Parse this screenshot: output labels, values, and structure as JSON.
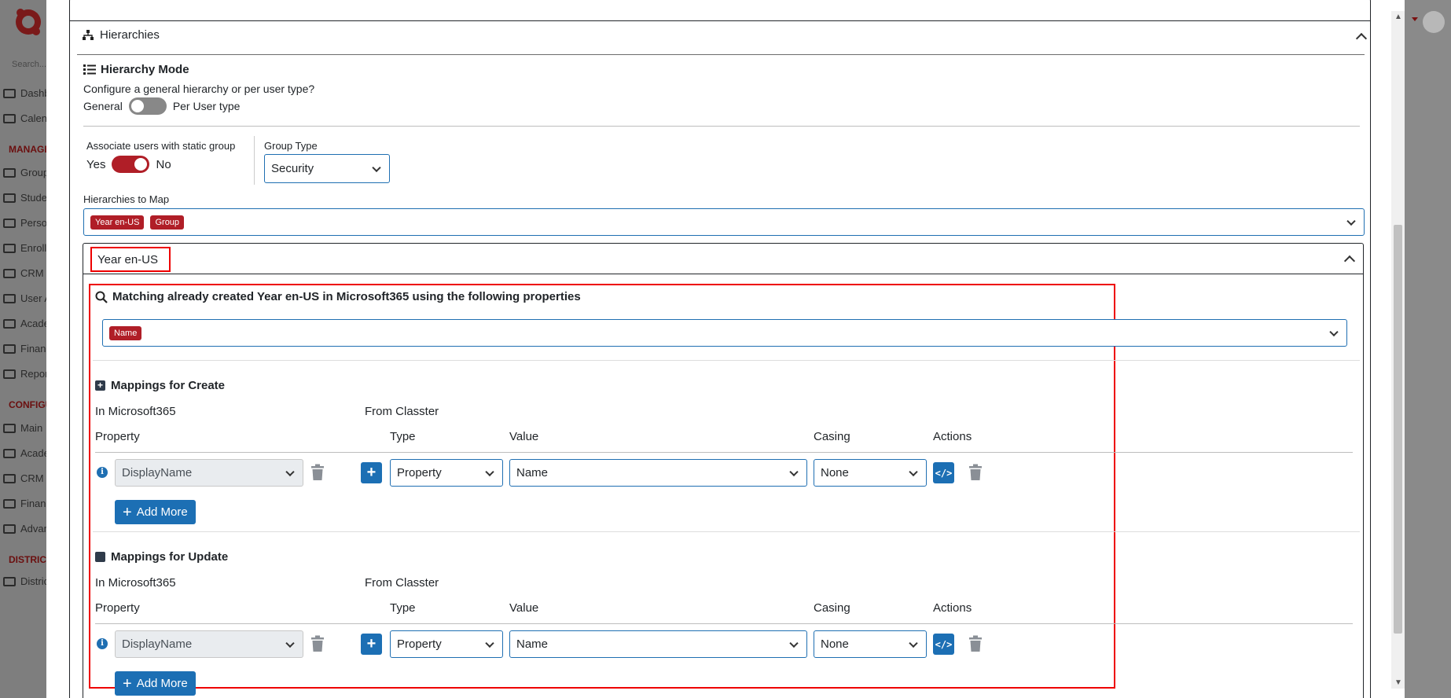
{
  "background": {
    "search_placeholder": "Search...",
    "items": [
      {
        "label": "Dashboard",
        "icon": "laptop-icon"
      },
      {
        "label": "Calendar",
        "icon": "calendar-icon"
      },
      {
        "label": "Groups",
        "icon": "groups-icon"
      },
      {
        "label": "Students",
        "icon": "students-icon"
      },
      {
        "label": "Persons",
        "icon": "person-icon"
      },
      {
        "label": "Enrollments",
        "icon": "enroll-icon"
      },
      {
        "label": "CRM",
        "icon": "crm-icon"
      },
      {
        "label": "User Access",
        "icon": "key-icon"
      },
      {
        "label": "Academics",
        "icon": "grid-icon"
      },
      {
        "label": "Finance",
        "icon": "coins-icon"
      },
      {
        "label": "Reports",
        "icon": "report-icon"
      },
      {
        "label": "Main",
        "icon": "sliders-icon"
      },
      {
        "label": "Academics",
        "icon": "grid-icon"
      },
      {
        "label": "CRM Settings",
        "icon": "crm-icon"
      },
      {
        "label": "Finance",
        "icon": "coins-icon"
      },
      {
        "label": "Advanced",
        "icon": "gear-icon"
      },
      {
        "label": "Districts",
        "icon": "list-icon"
      }
    ],
    "sections": [
      "MANAGE",
      "CONFIGURE",
      "DISTRICTS"
    ]
  },
  "hierarchies": {
    "title": "Hierarchies",
    "mode_title": "Hierarchy Mode",
    "mode_desc": "Configure a general hierarchy or per user type?",
    "toggle_left": "General",
    "toggle_right": "Per User type",
    "associate_label": "Associate users with static group",
    "associate_yes": "Yes",
    "associate_no": "No",
    "group_type_label": "Group Type",
    "group_type_value": "Security",
    "map_label": "Hierarchies to Map",
    "map_tags": [
      "Year en-US",
      "Group"
    ]
  },
  "year_panel": {
    "title": "Year en-US",
    "match_title": "Matching already created Year en-US in Microsoft365 using the following properties",
    "match_tags": [
      "Name"
    ],
    "create": {
      "title": "Mappings for Create",
      "in_label": "In Microsoft365",
      "from_label": "From Classter",
      "col_property": "Property",
      "col_type": "Type",
      "col_value": "Value",
      "col_casing": "Casing",
      "col_actions": "Actions",
      "property_value": "DisplayName",
      "type_value": "Property",
      "value_value": "Name",
      "casing_value": "None",
      "add_more": "Add More"
    },
    "update": {
      "title": "Mappings for Update",
      "in_label": "In Microsoft365",
      "from_label": "From Classter",
      "col_property": "Property",
      "col_type": "Type",
      "col_value": "Value",
      "col_casing": "Casing",
      "col_actions": "Actions",
      "property_value": "DisplayName",
      "type_value": "Property",
      "value_value": "Name",
      "casing_value": "None",
      "add_more": "Add More"
    }
  },
  "colors": {
    "accent_red": "#b01e27",
    "primary_blue": "#1c6fb4",
    "highlight_red": "#ee0000"
  }
}
